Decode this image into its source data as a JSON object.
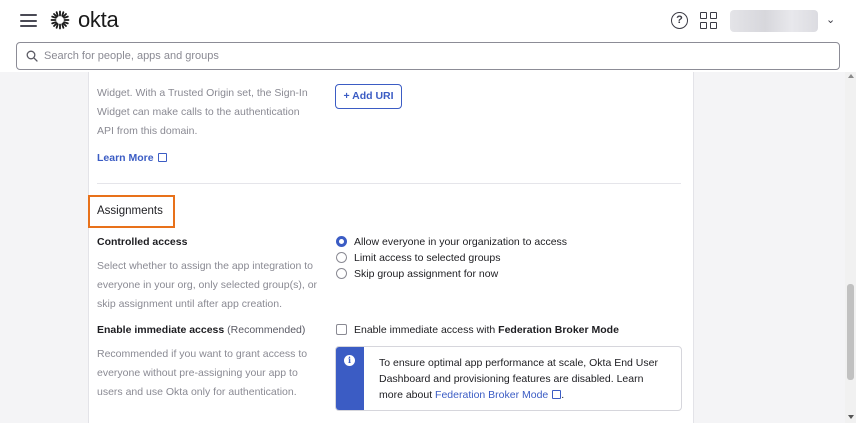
{
  "header": {
    "brand": "okta",
    "help_icon": "question-circle-icon",
    "apps_icon": "grid-icon",
    "user_caret": "⌄"
  },
  "search": {
    "placeholder": "Search for people, apps and groups"
  },
  "trusted_origin": {
    "description_partial": "Widget. With a Trusted Origin set, the Sign-In Widget can make calls to the authentication API from this domain.",
    "learn_more": "Learn More",
    "add_uri_button": "+ Add URI"
  },
  "assignments": {
    "title": "Assignments",
    "controlled_access": {
      "label": "Controlled access",
      "description": "Select whether to assign the app integration to everyone in your org, only selected group(s), or skip assignment until after app creation.",
      "options": [
        {
          "label": "Allow everyone in your organization to access",
          "selected": true
        },
        {
          "label": "Limit access to selected groups",
          "selected": false
        },
        {
          "label": "Skip group assignment for now",
          "selected": false
        }
      ]
    },
    "immediate_access": {
      "label": "Enable immediate access",
      "label_suffix": "(Recommended)",
      "description": "Recommended if you want to grant access to everyone without pre-assigning your app to users and use Okta only for authentication.",
      "checkbox_prefix": "Enable immediate access with ",
      "checkbox_bold": "Federation Broker Mode",
      "checked": false,
      "callout_text": "To ensure optimal app performance at scale, Okta End User Dashboard and provisioning features are disabled. Learn more about ",
      "callout_link": "Federation Broker Mode",
      "callout_end": "."
    }
  },
  "colors": {
    "accent": "#3b5cc4",
    "highlight": "#e8711a"
  }
}
